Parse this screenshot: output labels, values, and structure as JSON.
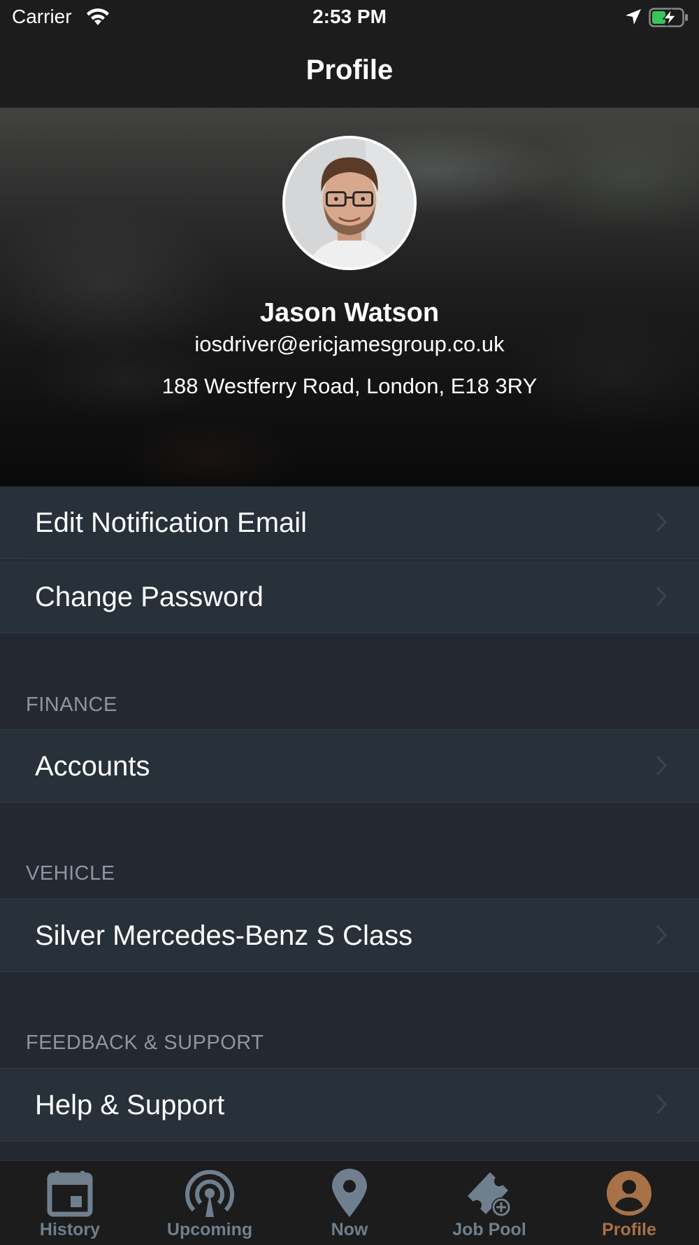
{
  "status_bar": {
    "carrier": "Carrier",
    "time": "2:53 PM",
    "icons": [
      "wifi-icon",
      "location-arrow-icon",
      "battery-charging-icon"
    ]
  },
  "nav": {
    "title": "Profile"
  },
  "profile": {
    "name": "Jason Watson",
    "email": "iosdriver@ericjamesgroup.co.uk",
    "address": "188 Westferry Road, London, E18 3RY"
  },
  "account_items": [
    {
      "label": "Edit Notification Email"
    },
    {
      "label": "Change Password"
    }
  ],
  "finance": {
    "header": "FINANCE",
    "items": [
      {
        "label": "Accounts"
      }
    ]
  },
  "vehicle": {
    "header": "VEHICLE",
    "items": [
      {
        "label": "Silver Mercedes-Benz S Class"
      }
    ]
  },
  "support": {
    "header": "FEEDBACK & SUPPORT",
    "items": [
      {
        "label": "Help & Support"
      }
    ]
  },
  "tabs": [
    {
      "label": "History",
      "icon": "calendar-icon",
      "active": false
    },
    {
      "label": "Upcoming",
      "icon": "broadcast-icon",
      "active": false
    },
    {
      "label": "Now",
      "icon": "map-pin-icon",
      "active": false
    },
    {
      "label": "Job Pool",
      "icon": "ticket-add-icon",
      "active": false
    },
    {
      "label": "Profile",
      "icon": "user-circle-icon",
      "active": true
    }
  ],
  "colors": {
    "background": "#232831",
    "row": "#28303a",
    "bar": "#1c1c1c",
    "tab_inactive": "#6f7f8e",
    "tab_active": "#a87246",
    "section_header": "#8e96a1"
  }
}
